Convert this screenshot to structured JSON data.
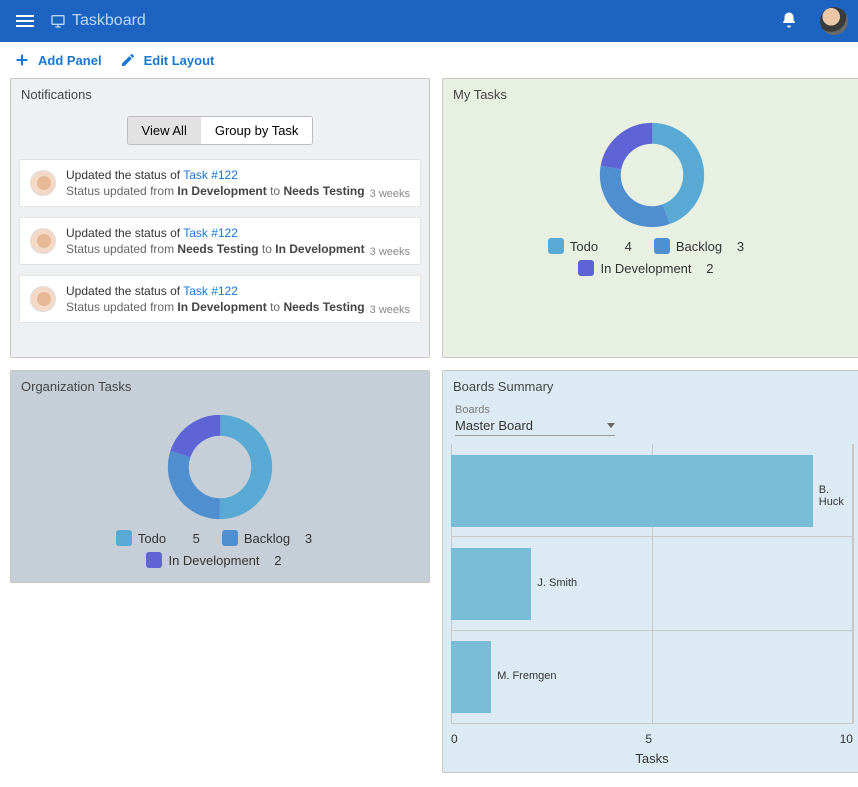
{
  "app": {
    "title": "Taskboard"
  },
  "toolbar": {
    "add_panel": "Add Panel",
    "edit_layout": "Edit Layout"
  },
  "notifications": {
    "title": "Notifications",
    "tabs": {
      "view_all": "View All",
      "group_by_task": "Group by Task",
      "active": "view_all"
    },
    "items": [
      {
        "prefix": "Updated the status of ",
        "task": "Task #122",
        "from": "In Development",
        "to": "Needs Testing",
        "time": "3 weeks"
      },
      {
        "prefix": "Updated the status of ",
        "task": "Task #122",
        "from": "Needs Testing",
        "to": "In Development",
        "time": "3 weeks"
      },
      {
        "prefix": "Updated the status of ",
        "task": "Task #122",
        "from": "In Development",
        "to": "Needs Testing",
        "time": "3 weeks"
      }
    ],
    "status_template": {
      "prefix": "Status updated from ",
      "mid": " to "
    }
  },
  "my_tasks": {
    "title": "My Tasks",
    "legend": [
      {
        "label": "Todo",
        "value": 4,
        "color": "#58a9d3"
      },
      {
        "label": "Backlog",
        "value": 3,
        "color": "#4f8fd0"
      },
      {
        "label": "In Development",
        "value": 2,
        "color": "#5e63d6"
      }
    ]
  },
  "org_tasks": {
    "title": "Organization Tasks",
    "legend": [
      {
        "label": "Todo",
        "value": 5,
        "color": "#58a9d3"
      },
      {
        "label": "Backlog",
        "value": 3,
        "color": "#4f8fd0"
      },
      {
        "label": "In Development",
        "value": 2,
        "color": "#5e63d6"
      }
    ]
  },
  "boards": {
    "title": "Boards Summary",
    "select_label": "Boards",
    "selected": "Master Board",
    "xlabel": "Tasks",
    "ticks": [
      "0",
      "5",
      "10"
    ],
    "rows": [
      {
        "name": "B. Huck",
        "value": 9
      },
      {
        "name": "J. Smith",
        "value": 2
      },
      {
        "name": "M. Fremgen",
        "value": 1
      }
    ],
    "xmax": 10
  },
  "chart_data": [
    {
      "type": "pie",
      "title": "My Tasks",
      "series": [
        {
          "name": "My Tasks",
          "values": [
            4,
            3,
            2
          ]
        }
      ],
      "categories": [
        "Todo",
        "Backlog",
        "In Development"
      ]
    },
    {
      "type": "pie",
      "title": "Organization Tasks",
      "series": [
        {
          "name": "Organization Tasks",
          "values": [
            5,
            3,
            2
          ]
        }
      ],
      "categories": [
        "Todo",
        "Backlog",
        "In Development"
      ]
    },
    {
      "type": "bar",
      "orientation": "horizontal",
      "title": "Boards Summary",
      "xlabel": "Tasks",
      "categories": [
        "B. Huck",
        "J. Smith",
        "M. Fremgen"
      ],
      "values": [
        9,
        2,
        1
      ],
      "xlim": [
        0,
        10
      ]
    }
  ]
}
